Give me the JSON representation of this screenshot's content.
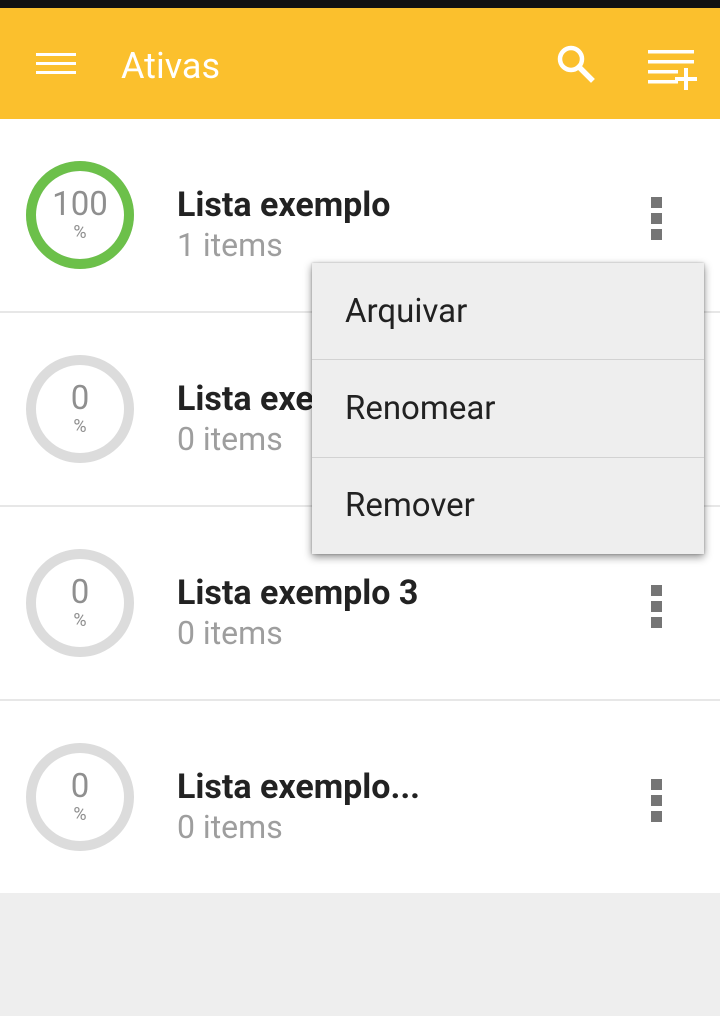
{
  "appbar": {
    "title": "Ativas",
    "background": "#fbc02d",
    "icons": [
      "menu-icon",
      "search-icon",
      "playlist-add-icon"
    ]
  },
  "lists": [
    {
      "title": "Lista exemplo",
      "subtitle": "1 items",
      "progress_value": "100",
      "progress_unit": "%",
      "progress_fraction": 1.0
    },
    {
      "title": "Lista exe",
      "subtitle": "0 items",
      "progress_value": "0",
      "progress_unit": "%",
      "progress_fraction": 0.0
    },
    {
      "title": "Lista exemplo 3",
      "subtitle": "0 items",
      "progress_value": "0",
      "progress_unit": "%",
      "progress_fraction": 0.0
    },
    {
      "title": "Lista exemplo...",
      "subtitle": "0 items",
      "progress_value": "0",
      "progress_unit": "%",
      "progress_fraction": 0.0
    }
  ],
  "popup_menu": {
    "items": [
      "Arquivar",
      "Renomear",
      "Remover"
    ]
  },
  "colors": {
    "progress_complete": "#6cc04a",
    "progress_track": "#dcdcdc"
  }
}
